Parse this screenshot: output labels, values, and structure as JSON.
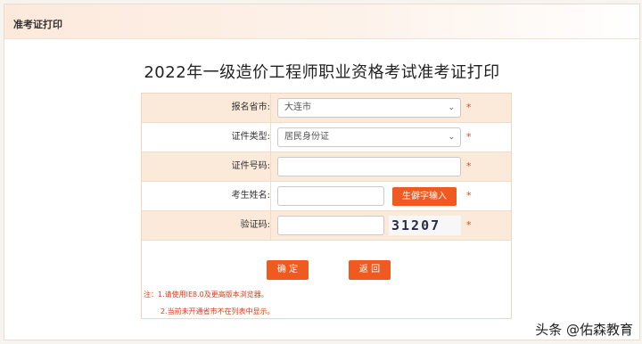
{
  "titlebar": {
    "title": "准考证打印"
  },
  "page_title": "2022年一级造价工程师职业资格考试准考证打印",
  "form": {
    "province": {
      "label": "报名省市:",
      "value": "大连市"
    },
    "id_type": {
      "label": "证件类型:",
      "value": "居民身份证"
    },
    "id_number": {
      "label": "证件号码:",
      "value": ""
    },
    "name": {
      "label": "考生姓名:",
      "value": "",
      "rare_char_button": "生僻字输入"
    },
    "captcha": {
      "label": "验证码:",
      "value": "",
      "image_text": "31207"
    },
    "required_mark": "*"
  },
  "buttons": {
    "confirm": "确 定",
    "back": "返 回"
  },
  "notes": {
    "line1": "注：1.请使用IE8.0及更高版本浏览器。",
    "line2": "2.当前未开通省市不在列表中显示。"
  },
  "watermark": "头条 @佑森教育",
  "colors": {
    "accent": "#f05a20",
    "row_shade": "#fbe9da",
    "required": "#e04a1f"
  }
}
